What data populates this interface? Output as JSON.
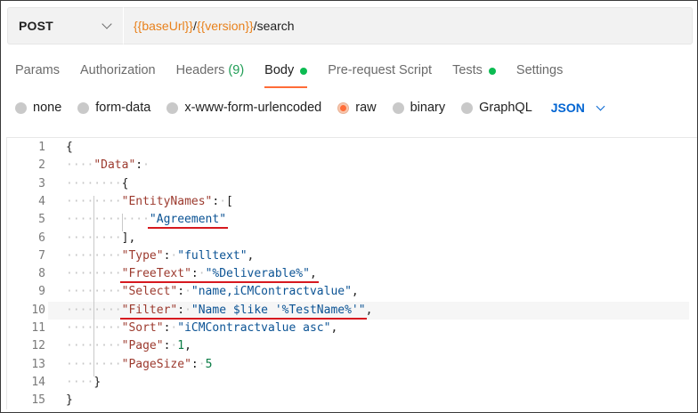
{
  "request": {
    "method": "POST",
    "url_parts": [
      {
        "text": "{{baseUrl}}",
        "kind": "var"
      },
      {
        "text": "/",
        "kind": "plain"
      },
      {
        "text": "{{version}}",
        "kind": "var"
      },
      {
        "text": "/search",
        "kind": "plain"
      }
    ]
  },
  "tabs": [
    {
      "label": "Params"
    },
    {
      "label": "Authorization"
    },
    {
      "label": "Headers",
      "count": "(9)"
    },
    {
      "label": "Body",
      "dot": true,
      "active": true
    },
    {
      "label": "Pre-request Script"
    },
    {
      "label": "Tests",
      "dot": true
    },
    {
      "label": "Settings"
    }
  ],
  "body_types": {
    "options": [
      "none",
      "form-data",
      "x-www-form-urlencoded",
      "raw",
      "binary",
      "GraphQL"
    ],
    "selected": "raw",
    "format": "JSON"
  },
  "editor": {
    "line_numbers": [
      "1",
      "2",
      "3",
      "4",
      "5",
      "6",
      "7",
      "8",
      "9",
      "10",
      "11",
      "12",
      "13",
      "14",
      "15"
    ],
    "lines": [
      [
        {
          "t": "{",
          "c": "p"
        }
      ],
      [
        {
          "t": "····",
          "c": "ws"
        },
        {
          "t": "\"Data\"",
          "c": "k"
        },
        {
          "t": ":",
          "c": "p"
        },
        {
          "t": "·",
          "c": "ws"
        }
      ],
      [
        {
          "t": "········",
          "c": "ws"
        },
        {
          "t": "{",
          "c": "p"
        }
      ],
      [
        {
          "t": "········",
          "c": "ws"
        },
        {
          "t": "\"EntityNames\"",
          "c": "k"
        },
        {
          "t": ":",
          "c": "p"
        },
        {
          "t": "·",
          "c": "ws"
        },
        {
          "t": "[",
          "c": "p"
        }
      ],
      [
        {
          "t": "············",
          "c": "ws"
        },
        {
          "t": "\"Agreement\"",
          "c": "s"
        }
      ],
      [
        {
          "t": "········",
          "c": "ws"
        },
        {
          "t": "],",
          "c": "p"
        }
      ],
      [
        {
          "t": "········",
          "c": "ws"
        },
        {
          "t": "\"Type\"",
          "c": "k"
        },
        {
          "t": ":",
          "c": "p"
        },
        {
          "t": "·",
          "c": "ws"
        },
        {
          "t": "\"fulltext\"",
          "c": "s"
        },
        {
          "t": ",",
          "c": "p"
        }
      ],
      [
        {
          "t": "········",
          "c": "ws"
        },
        {
          "t": "\"FreeText\"",
          "c": "k"
        },
        {
          "t": ":",
          "c": "p"
        },
        {
          "t": "·",
          "c": "ws"
        },
        {
          "t": "\"%Deliverable%\"",
          "c": "s"
        },
        {
          "t": ",",
          "c": "p"
        }
      ],
      [
        {
          "t": "········",
          "c": "ws"
        },
        {
          "t": "\"Select\"",
          "c": "k"
        },
        {
          "t": ":",
          "c": "p"
        },
        {
          "t": "·",
          "c": "ws"
        },
        {
          "t": "\"name,iCMContractvalue\"",
          "c": "s"
        },
        {
          "t": ",",
          "c": "p"
        }
      ],
      [
        {
          "t": "········",
          "c": "ws"
        },
        {
          "t": "\"Filter\"",
          "c": "k"
        },
        {
          "t": ":",
          "c": "p"
        },
        {
          "t": "·",
          "c": "ws"
        },
        {
          "t": "\"Name $like '%TestName%'\"",
          "c": "s"
        },
        {
          "t": ",",
          "c": "p"
        }
      ],
      [
        {
          "t": "········",
          "c": "ws"
        },
        {
          "t": "\"Sort\"",
          "c": "k"
        },
        {
          "t": ":",
          "c": "p"
        },
        {
          "t": "·",
          "c": "ws"
        },
        {
          "t": "\"iCMContractvalue asc\"",
          "c": "s"
        },
        {
          "t": ",",
          "c": "p"
        }
      ],
      [
        {
          "t": "········",
          "c": "ws"
        },
        {
          "t": "\"Page\"",
          "c": "k"
        },
        {
          "t": ":",
          "c": "p"
        },
        {
          "t": "·",
          "c": "ws"
        },
        {
          "t": "1",
          "c": "n"
        },
        {
          "t": ",",
          "c": "p"
        }
      ],
      [
        {
          "t": "········",
          "c": "ws"
        },
        {
          "t": "\"PageSize\"",
          "c": "k"
        },
        {
          "t": ":",
          "c": "p"
        },
        {
          "t": "·",
          "c": "ws"
        },
        {
          "t": "5",
          "c": "n"
        }
      ],
      [
        {
          "t": "····",
          "c": "ws"
        },
        {
          "t": "}",
          "c": "p"
        }
      ],
      [
        {
          "t": "}",
          "c": "p"
        }
      ]
    ],
    "current_line": 10
  },
  "colors": {
    "accent": "#ff6c37",
    "url_variable": "#e8811c",
    "json_key": "#9c3a2e",
    "json_string": "#0b5394",
    "json_number": "#0a7c45",
    "status_dot": "#0cbb52",
    "annotation_underline": "#d6191f"
  }
}
